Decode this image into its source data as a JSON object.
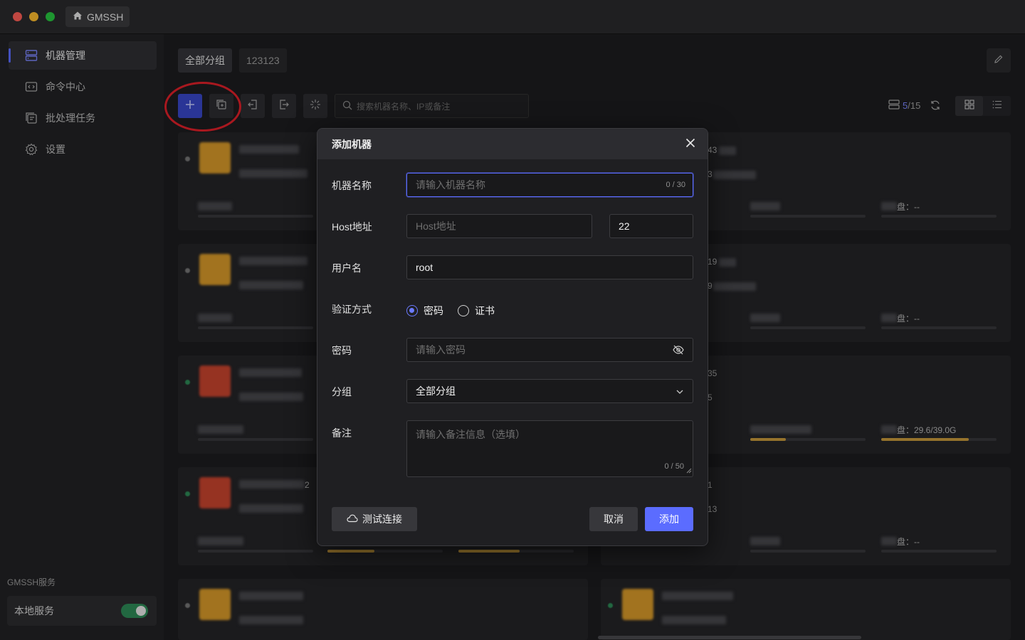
{
  "app": {
    "title": "GMSSH"
  },
  "sidebar": {
    "items": [
      {
        "label": "机器管理",
        "icon": "server-icon",
        "active": true
      },
      {
        "label": "命令中心",
        "icon": "code-icon",
        "active": false
      },
      {
        "label": "批处理任务",
        "icon": "batch-icon",
        "active": false
      },
      {
        "label": "设置",
        "icon": "gear-icon",
        "active": false
      }
    ],
    "service_section": "GMSSH服务",
    "local_service_label": "本地服务",
    "local_service_enabled": true
  },
  "groups": {
    "tabs": [
      "全部分组",
      "123123"
    ],
    "selected": "全部分组"
  },
  "toolbar": {
    "search_placeholder": "搜索机器名称、IP或备注",
    "count_current": "5",
    "count_sep": "/15"
  },
  "cards_visible_text": {
    "disk_label_1": "盘：--",
    "disk_label_2": "盘：--",
    "disk_label_3": "盘：29.6/39.0G",
    "disk_label_4": "盘：--",
    "frag_1": "43",
    "frag_2": "3",
    "frag_3": "19",
    "frag_4": "9",
    "frag_5": "35",
    "frag_6": "5",
    "frag_7": "1",
    "frag_8": "13",
    "frag_9": "2"
  },
  "dialog": {
    "title": "添加机器",
    "fields": {
      "name": {
        "label": "机器名称",
        "placeholder": "请输入机器名称",
        "counter": "0 / 30"
      },
      "host": {
        "label": "Host地址",
        "placeholder": "Host地址",
        "port": "22"
      },
      "user": {
        "label": "用户名",
        "value": "root"
      },
      "auth": {
        "label": "验证方式",
        "options": [
          "密码",
          "证书"
        ],
        "selected": "密码"
      },
      "password": {
        "label": "密码",
        "placeholder": "请输入密码"
      },
      "group": {
        "label": "分组",
        "value": "全部分组"
      },
      "remark": {
        "label": "备注",
        "placeholder": "请输入备注信息（选填）",
        "counter": "0 / 50"
      }
    },
    "buttons": {
      "test": "测试连接",
      "cancel": "取消",
      "add": "添加"
    }
  },
  "colors": {
    "accent": "#5b6cff",
    "highlight_circle": "#e0202a",
    "toggle_on": "#2e8b57",
    "progress": "#c89a3b"
  }
}
